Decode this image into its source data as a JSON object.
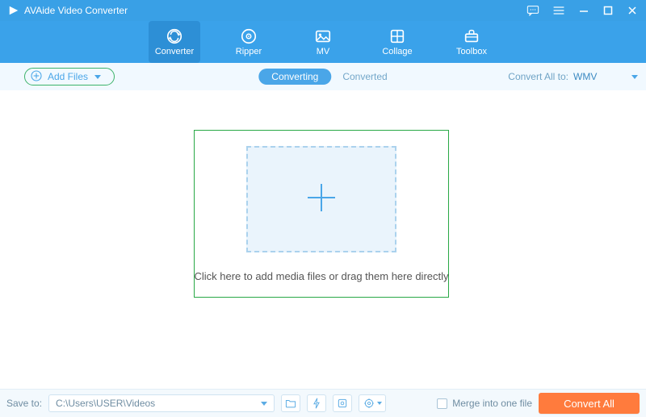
{
  "titlebar": {
    "app_name": "AVAide Video Converter"
  },
  "nav": {
    "items": [
      {
        "label": "Converter"
      },
      {
        "label": "Ripper"
      },
      {
        "label": "MV"
      },
      {
        "label": "Collage"
      },
      {
        "label": "Toolbox"
      }
    ]
  },
  "subbar": {
    "add_files_label": "Add Files",
    "status_active": "Converting",
    "status_inactive": "Converted",
    "convert_all_label": "Convert All to:",
    "convert_all_value": "WMV"
  },
  "main": {
    "drop_message": "Click here to add media files or drag them here directly"
  },
  "footer": {
    "save_to_label": "Save to:",
    "save_to_path": "C:\\Users\\USER\\Videos",
    "merge_label": "Merge into one file",
    "convert_btn": "Convert All"
  }
}
